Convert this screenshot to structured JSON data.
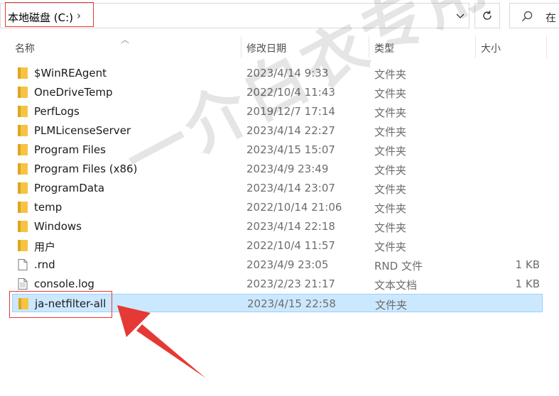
{
  "address_bar": {
    "path": "本地磁盘 (C:)",
    "chevron": "›"
  },
  "search": {
    "placeholder": "在"
  },
  "columns": {
    "name": "名称",
    "modified": "修改日期",
    "type": "类型",
    "size": "大小"
  },
  "files": [
    {
      "name": "$WinREAgent",
      "date": "2023/4/14 9:33",
      "type": "文件夹",
      "size": "",
      "kind": "folder"
    },
    {
      "name": "OneDriveTemp",
      "date": "2022/10/4 11:43",
      "type": "文件夹",
      "size": "",
      "kind": "folder"
    },
    {
      "name": "PerfLogs",
      "date": "2019/12/7 17:14",
      "type": "文件夹",
      "size": "",
      "kind": "folder"
    },
    {
      "name": "PLMLicenseServer",
      "date": "2023/4/14 22:27",
      "type": "文件夹",
      "size": "",
      "kind": "folder"
    },
    {
      "name": "Program Files",
      "date": "2023/4/15 15:07",
      "type": "文件夹",
      "size": "",
      "kind": "folder"
    },
    {
      "name": "Program Files (x86)",
      "date": "2023/4/9 23:49",
      "type": "文件夹",
      "size": "",
      "kind": "folder"
    },
    {
      "name": "ProgramData",
      "date": "2023/4/14 23:07",
      "type": "文件夹",
      "size": "",
      "kind": "folder"
    },
    {
      "name": "temp",
      "date": "2022/10/14 21:06",
      "type": "文件夹",
      "size": "",
      "kind": "folder"
    },
    {
      "name": "Windows",
      "date": "2023/4/14 22:18",
      "type": "文件夹",
      "size": "",
      "kind": "folder"
    },
    {
      "name": "用户",
      "date": "2022/10/4 11:57",
      "type": "文件夹",
      "size": "",
      "kind": "folder"
    },
    {
      "name": ".rnd",
      "date": "2023/4/9 23:05",
      "type": "RND 文件",
      "size": "1 KB",
      "kind": "file"
    },
    {
      "name": "console.log",
      "date": "2023/2/23 21:17",
      "type": "文本文档",
      "size": "1 KB",
      "kind": "text"
    },
    {
      "name": "ja-netfilter-all",
      "date": "2023/4/15 22:58",
      "type": "文件夹",
      "size": "",
      "kind": "folder",
      "selected": true
    }
  ],
  "watermark": "一介白衣专用",
  "colors": {
    "folder": "#f6c343",
    "selection": "#cce8ff",
    "highlight": "#e53935"
  }
}
